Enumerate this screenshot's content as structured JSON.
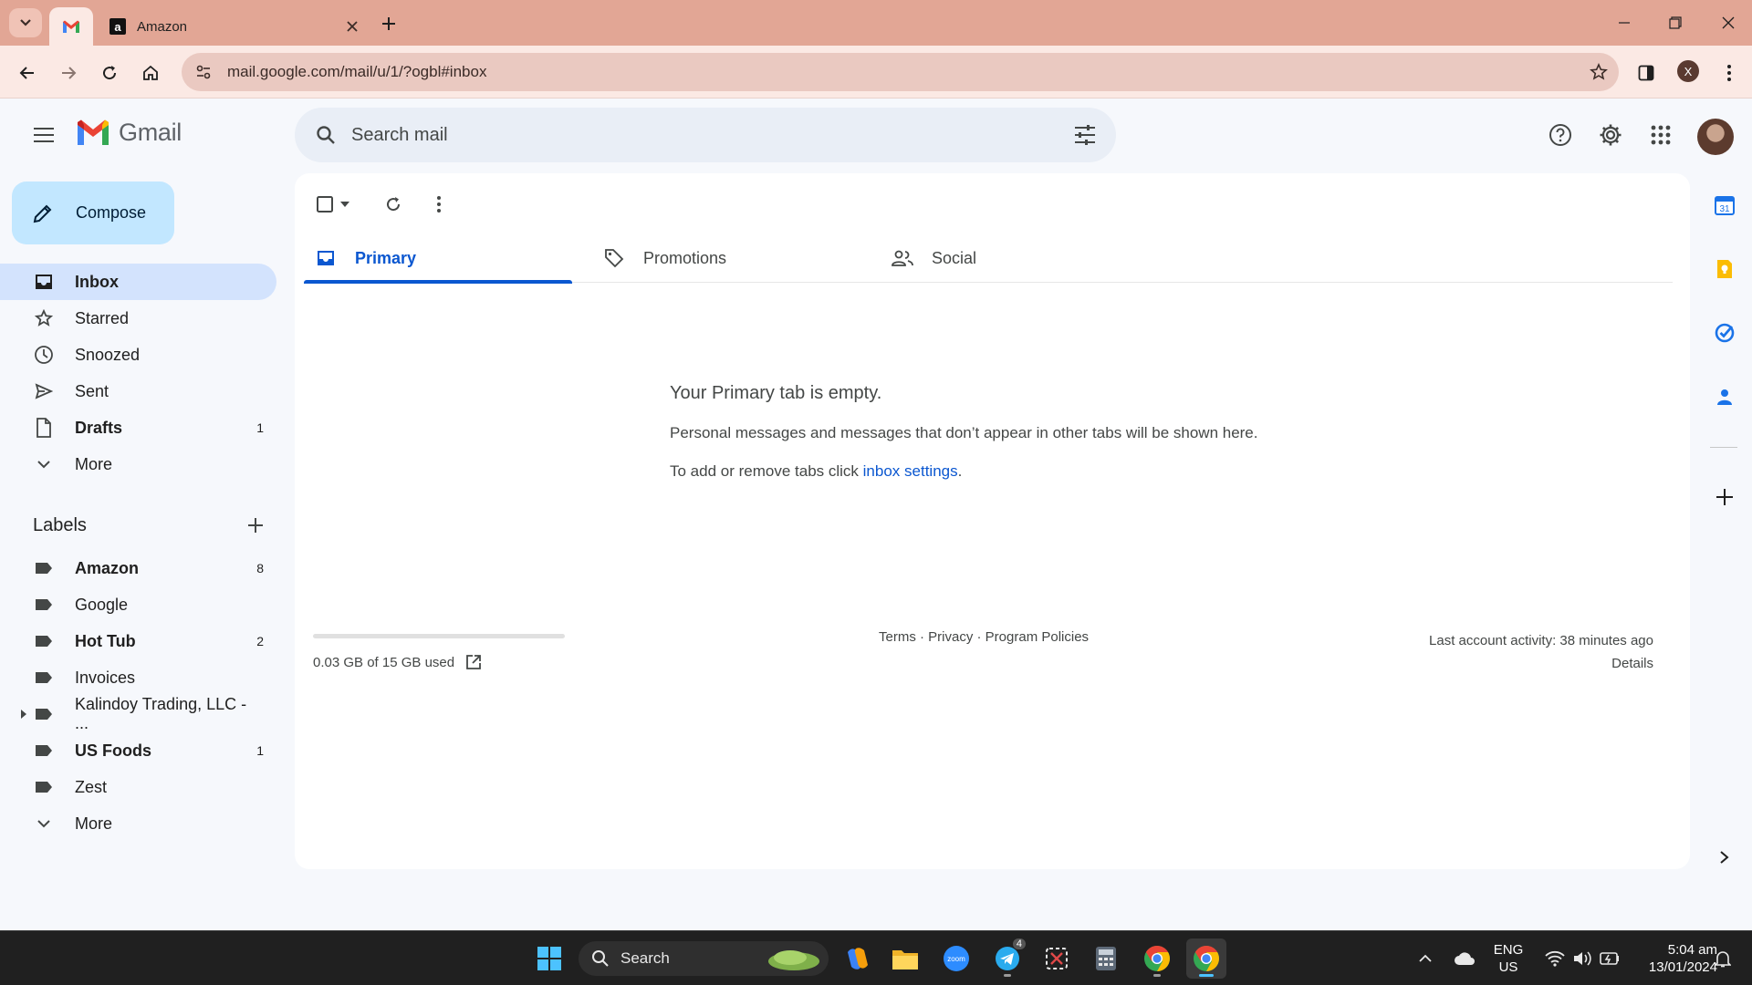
{
  "browser": {
    "tabs": [
      {
        "title": "",
        "icon": "gmail-icon",
        "active": true
      },
      {
        "title": "Amazon",
        "icon": "amazon-icon",
        "active": false
      }
    ],
    "url": "mail.google.com/mail/u/1/?ogbl#inbox",
    "profile_initial": "X"
  },
  "gmail": {
    "logo_text": "Gmail",
    "search_placeholder": "Search mail",
    "compose_label": "Compose",
    "nav": [
      {
        "label": "Inbox",
        "count": "",
        "icon": "inbox-icon",
        "active": true,
        "bold": true
      },
      {
        "label": "Starred",
        "count": "",
        "icon": "star-icon",
        "active": false,
        "bold": false
      },
      {
        "label": "Snoozed",
        "count": "",
        "icon": "clock-icon",
        "active": false,
        "bold": false
      },
      {
        "label": "Sent",
        "count": "",
        "icon": "send-icon",
        "active": false,
        "bold": false
      },
      {
        "label": "Drafts",
        "count": "1",
        "icon": "draft-icon",
        "active": false,
        "bold": true
      },
      {
        "label": "More",
        "count": "",
        "icon": "chevron-down-icon",
        "active": false,
        "bold": false
      }
    ],
    "labels_title": "Labels",
    "labels": [
      {
        "label": "Amazon",
        "count": "8",
        "bold": true
      },
      {
        "label": "Google",
        "count": "",
        "bold": false
      },
      {
        "label": "Hot Tub",
        "count": "2",
        "bold": true
      },
      {
        "label": "Invoices",
        "count": "",
        "bold": false
      },
      {
        "label": "Kalindoy Trading, LLC - ...",
        "count": "",
        "bold": false
      },
      {
        "label": "US Foods",
        "count": "1",
        "bold": true
      },
      {
        "label": "Zest",
        "count": "",
        "bold": false
      },
      {
        "label": "More",
        "count": "",
        "bold": false
      }
    ],
    "category_tabs": [
      {
        "label": "Primary",
        "icon": "inbox-icon",
        "active": true
      },
      {
        "label": "Promotions",
        "icon": "tag-icon",
        "active": false
      },
      {
        "label": "Social",
        "icon": "people-icon",
        "active": false
      }
    ],
    "empty_state": {
      "title": "Your Primary tab is empty.",
      "line1": "Personal messages and messages that don’t appear in other tabs will be shown here.",
      "line2_prefix": "To add or remove tabs click ",
      "line2_link": "inbox settings",
      "line2_suffix": "."
    },
    "storage": {
      "text": "0.03 GB of 15 GB used",
      "used_fraction": 0.002
    },
    "footer_links": "Terms · Privacy · Program Policies",
    "last_activity": "Last account activity: 38 minutes ago",
    "details": "Details"
  },
  "taskbar": {
    "search_label": "Search",
    "telegram_badge": "4",
    "language": "ENG",
    "region": "US",
    "time": "5:04 am",
    "date": "13/01/2024"
  },
  "colors": {
    "accent": "#0b57d0",
    "compose_bg": "#c2e7ff",
    "nav_active_bg": "#d3e3fd",
    "chrome_tabstrip": "#e2a695"
  }
}
